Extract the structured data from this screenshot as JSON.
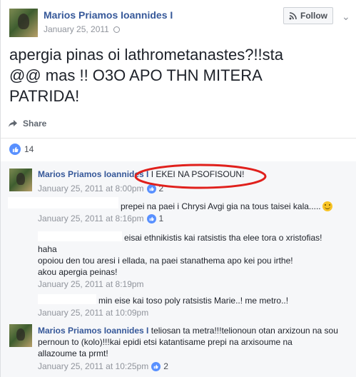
{
  "post": {
    "author": "Marios Priamos Ioannides I",
    "date": "January 25, 2011",
    "follow_label": "Follow",
    "text_line1": "apergia pinas oi lathrometanastes?!!sta",
    "text_line2": "@@ mas !! O3O APO THN MITERA",
    "text_line3": "PATRIDA!",
    "share_label": "Share",
    "like_count": "14"
  },
  "comments": [
    {
      "author": "Marios Priamos Ioannides I",
      "text": "I EKEI NA PSOFISOUN!",
      "date": "January 25, 2011 at 8:00pm",
      "reactions": "2"
    },
    {
      "text": "prepei na paei i Chrysi Avgi gia na tous taisei kala.....",
      "date": "January 25, 2011 at 8:16pm",
      "reactions": "1"
    },
    {
      "text_line1": "eisai ethnikistis kai ratsistis tha elee tora o xristofias!",
      "text_line2": "haha",
      "text_line3": "opoiou den tou aresi i ellada, na paei stanathema apo kei pou irthe!",
      "text_line4": "akou apergia peinas!",
      "date": "January 25, 2011 at 8:19pm"
    },
    {
      "text": "min eise kai toso poly ratsistis Marie..! me metro..!",
      "date": "January 25, 2011 at 10:09pm"
    },
    {
      "author": "Marios Priamos Ioannides I",
      "text_line1": "teliosan ta metra!!!telionoun otan arxizoun na sou",
      "text_line2": "pernoun to (kolo)!!!kai epidi etsi katantisame prepi na arxisoume na",
      "text_line3": "allazoume ta prmt!",
      "date": "January 25, 2011 at 10:25pm",
      "reactions": "2"
    }
  ],
  "colors": {
    "link_blue": "#365899",
    "meta_gray": "#90949c",
    "annotation_red": "#e0201c",
    "like_blue": "#5890ff"
  }
}
